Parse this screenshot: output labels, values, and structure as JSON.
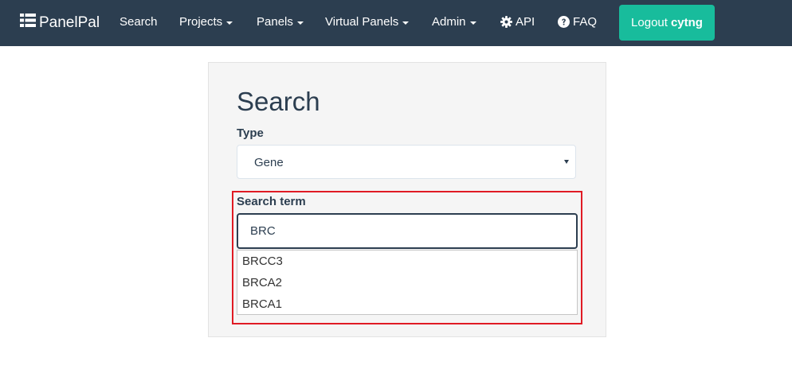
{
  "navbar": {
    "brand": "PanelPal",
    "items": [
      {
        "label": "Search"
      },
      {
        "label": "Projects"
      },
      {
        "label": "Panels"
      },
      {
        "label": "Virtual Panels"
      },
      {
        "label": "Admin"
      },
      {
        "label": "API",
        "icon": "gear-icon"
      },
      {
        "label": "FAQ",
        "icon": "question-circle-icon"
      }
    ],
    "logout": {
      "label": "Logout",
      "user": "cytng"
    },
    "background": "#2c3e50",
    "accent": "#18bc9c"
  },
  "search_form": {
    "title": "Search",
    "type_label": "Type",
    "type_value": "Gene",
    "term_label": "Search term",
    "term_value": "BRC",
    "suggestions": [
      "BRCC3",
      "BRCA2",
      "BRCA1"
    ],
    "highlight_color": "#e01b24"
  }
}
